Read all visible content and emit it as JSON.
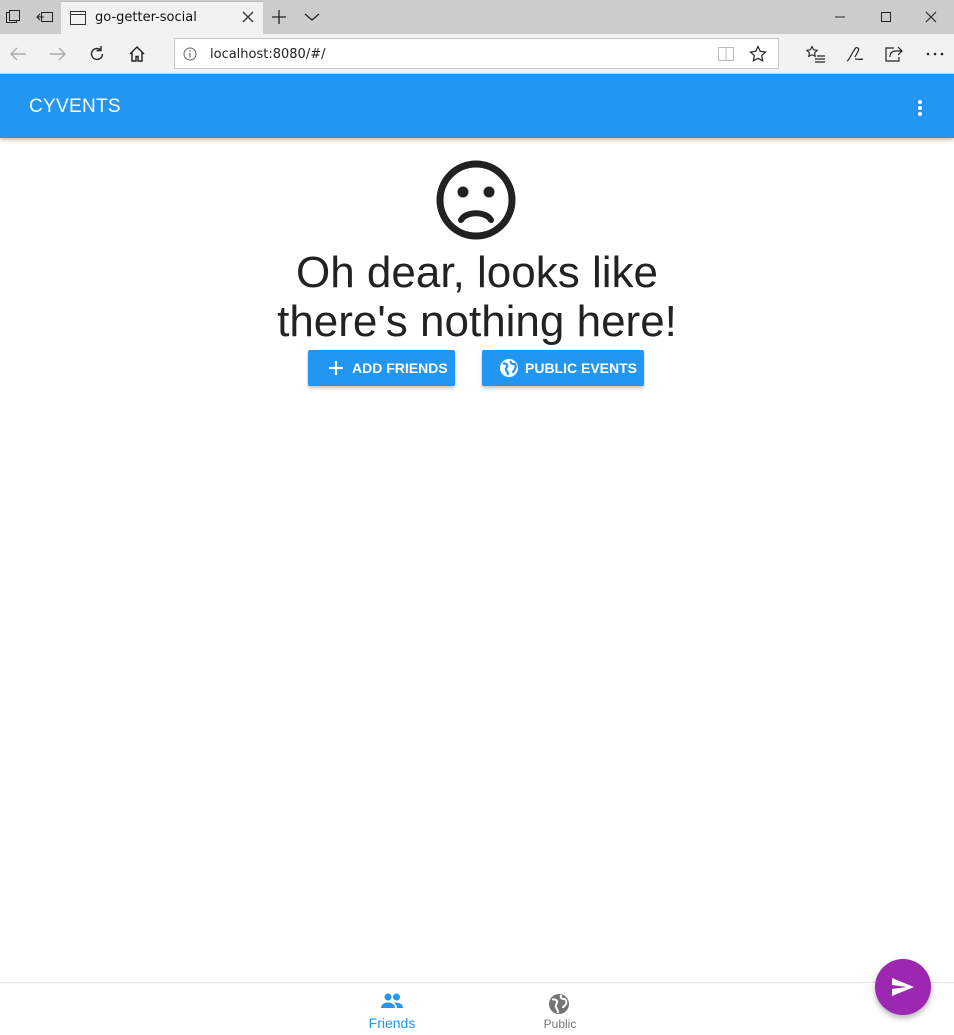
{
  "browser": {
    "tab_title": "go-getter-social",
    "url": "localhost:8080/#/"
  },
  "appbar": {
    "title": "CYVENTS"
  },
  "empty_state": {
    "icon": "sentiment-dissatisfied-icon",
    "line1": "Oh dear, looks like",
    "line2": "there's nothing here!"
  },
  "actions": {
    "add_friends": "ADD FRIENDS",
    "public_events": "PUBLIC EVENTS"
  },
  "bottom_nav": {
    "friends": "Friends",
    "public": "Public",
    "active": "Friends"
  },
  "colors": {
    "primary": "#2196f3",
    "fab": "#9c27b0",
    "inactive": "#757575"
  }
}
